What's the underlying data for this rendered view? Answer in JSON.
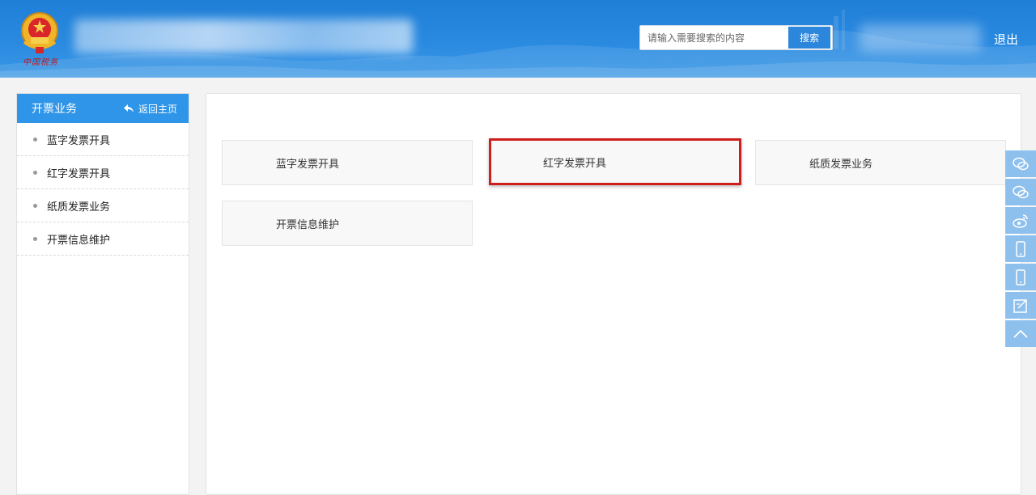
{
  "header": {
    "emblem_text": "中国税务",
    "search_placeholder": "请输入需要搜索的内容",
    "search_button": "搜索",
    "logout": "退出"
  },
  "sidebar": {
    "title": "开票业务",
    "back_home": "返回主页",
    "items": [
      {
        "label": "蓝字发票开具"
      },
      {
        "label": "红字发票开具"
      },
      {
        "label": "纸质发票业务"
      },
      {
        "label": "开票信息维护"
      }
    ]
  },
  "main": {
    "tiles": [
      {
        "label": "蓝字发票开具"
      },
      {
        "label": "红字发票开具"
      },
      {
        "label": "纸质发票业务"
      },
      {
        "label": "开票信息维护"
      }
    ]
  },
  "float_bar": {
    "icons": [
      "wechat-icon",
      "wechat-icon",
      "weibo-icon",
      "mobile-icon",
      "mobile-icon",
      "edit-icon",
      "chevron-up-icon"
    ]
  },
  "colors": {
    "header": "#2a8ae0",
    "sidebar_head": "#2f95e8",
    "highlight": "#d01d1d",
    "float_btn": "#8ec0ee"
  }
}
